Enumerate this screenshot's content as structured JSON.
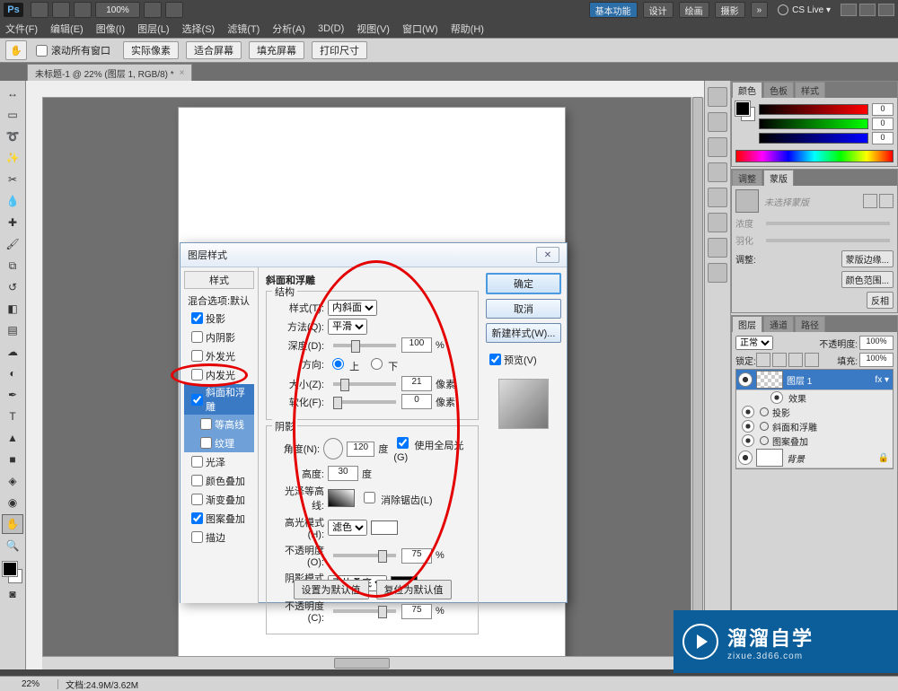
{
  "app": {
    "logo": "Ps",
    "zoom_pct": "100%",
    "workspaces": [
      "基本功能",
      "设计",
      "绘画",
      "摄影"
    ],
    "cs_live": "CS Live",
    "window_buttons": [
      "min",
      "restore",
      "close"
    ]
  },
  "menu": [
    "文件(F)",
    "编辑(E)",
    "图像(I)",
    "图层(L)",
    "选择(S)",
    "滤镜(T)",
    "分析(A)",
    "3D(D)",
    "视图(V)",
    "窗口(W)",
    "帮助(H)"
  ],
  "options": {
    "scroll_all": "滚动所有窗口",
    "buttons": [
      "实际像素",
      "适合屏幕",
      "填充屏幕",
      "打印尺寸"
    ]
  },
  "doctab": {
    "title": "未标题-1 @ 22% (图层 1, RGB/8) *"
  },
  "status": {
    "zoom": "22%",
    "doc": "文档:24.9M/3.62M"
  },
  "panels": {
    "color": {
      "tabs": [
        "颜色",
        "色板",
        "样式"
      ],
      "r": 0,
      "g": 0,
      "b": 0
    },
    "masks": {
      "tabs": [
        "调整",
        "蒙版"
      ],
      "placeholder": "未选择蒙版",
      "density_label": "浓度",
      "feather_label": "羽化",
      "refine_label": "调整:",
      "btn_mask_edge": "蒙版边缘...",
      "btn_color_range": "颜色范围...",
      "btn_invert": "反相"
    },
    "layers": {
      "tabs": [
        "图层",
        "通道",
        "路径"
      ],
      "blend": "正常",
      "opacity_label": "不透明度:",
      "opacity": "100%",
      "lock_label": "锁定:",
      "fill_label": "填充:",
      "fill": "100%",
      "layer1": "图层 1",
      "fx": "效果",
      "fx_items": [
        "投影",
        "斜面和浮雕",
        "图案叠加"
      ],
      "bg": "背景"
    }
  },
  "dlg": {
    "title": "图层样式",
    "side_header": "样式",
    "blend_default": "混合选项:默认",
    "styles": [
      {
        "label": "投影",
        "checked": true
      },
      {
        "label": "内阴影",
        "checked": false
      },
      {
        "label": "外发光",
        "checked": false
      },
      {
        "label": "内发光",
        "checked": false
      },
      {
        "label": "斜面和浮雕",
        "checked": true,
        "selected": true
      },
      {
        "label": "等高线",
        "checked": false,
        "sub": true,
        "sel2": true
      },
      {
        "label": "纹理",
        "checked": false,
        "sub": true,
        "sel2": true
      },
      {
        "label": "光泽",
        "checked": false
      },
      {
        "label": "颜色叠加",
        "checked": false
      },
      {
        "label": "渐变叠加",
        "checked": false
      },
      {
        "label": "图案叠加",
        "checked": true
      },
      {
        "label": "描边",
        "checked": false
      }
    ],
    "bevel": {
      "heading": "斜面和浮雕",
      "group_struct": "结构",
      "style_label": "样式(T):",
      "style_val": "内斜面",
      "tech_label": "方法(Q):",
      "tech_val": "平滑",
      "depth_label": "深度(D):",
      "depth_val": "100",
      "depth_unit": "%",
      "dir_label": "方向:",
      "dir_up": "上",
      "dir_down": "下",
      "size_label": "大小(Z):",
      "size_val": "21",
      "size_unit": "像素",
      "soft_label": "软化(F):",
      "soft_val": "0",
      "soft_unit": "像素",
      "group_shade": "阴影",
      "angle_label": "角度(N):",
      "angle_val": "120",
      "angle_unit": "度",
      "global": "使用全局光(G)",
      "alt_label": "高度:",
      "alt_val": "30",
      "alt_unit": "度",
      "gloss_label": "光泽等高线:",
      "anti": "消除锯齿(L)",
      "hi_mode_label": "高光模式(H):",
      "hi_mode": "滤色",
      "hi_op_label": "不透明度(O):",
      "hi_op": "75",
      "pct": "%",
      "sh_mode_label": "阴影模式(A):",
      "sh_mode": "正片叠底",
      "sh_op_label": "不透明度(C):",
      "sh_op": "75",
      "btn_default": "设置为默认值",
      "btn_reset": "复位为默认值"
    },
    "rightbtns": {
      "ok": "确定",
      "cancel": "取消",
      "new": "新建样式(W)...",
      "preview": "预览(V)"
    }
  },
  "watermark": {
    "title": "溜溜自学",
    "sub": "zixue.3d66.com"
  }
}
